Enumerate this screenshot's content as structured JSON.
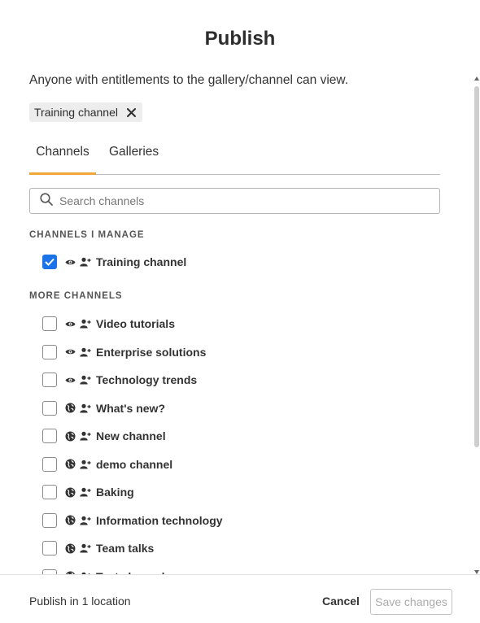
{
  "dialog": {
    "title": "Publish",
    "description": "Anyone with entitlements to the gallery/channel can view.",
    "selected_chip": {
      "label": "Training channel",
      "remove_icon": "close-icon"
    }
  },
  "tabs": [
    {
      "label": "Channels",
      "active": true
    },
    {
      "label": "Galleries",
      "active": false
    }
  ],
  "search": {
    "placeholder": "Search channels",
    "value": "",
    "icon": "search-icon"
  },
  "sections": {
    "managed": {
      "heading": "CHANNELS I MANAGE",
      "items": [
        {
          "label": "Training channel",
          "checked": true,
          "visibility_icon": "eye-icon",
          "member_icon": "person-add-icon"
        }
      ]
    },
    "more": {
      "heading": "MORE CHANNELS",
      "items": [
        {
          "label": "Video tutorials",
          "checked": false,
          "visibility_icon": "eye-icon",
          "member_icon": "person-add-icon"
        },
        {
          "label": "Enterprise solutions",
          "checked": false,
          "visibility_icon": "eye-icon",
          "member_icon": "person-add-icon"
        },
        {
          "label": "Technology trends",
          "checked": false,
          "visibility_icon": "eye-icon",
          "member_icon": "person-add-icon"
        },
        {
          "label": "What's new?",
          "checked": false,
          "visibility_icon": "globe-icon",
          "member_icon": "person-add-icon"
        },
        {
          "label": "New channel",
          "checked": false,
          "visibility_icon": "globe-icon",
          "member_icon": "person-add-icon"
        },
        {
          "label": "demo channel",
          "checked": false,
          "visibility_icon": "globe-icon",
          "member_icon": "person-add-icon"
        },
        {
          "label": "Baking",
          "checked": false,
          "visibility_icon": "globe-icon",
          "member_icon": "person-add-icon"
        },
        {
          "label": "Information technology",
          "checked": false,
          "visibility_icon": "globe-icon",
          "member_icon": "person-add-icon"
        },
        {
          "label": "Team talks",
          "checked": false,
          "visibility_icon": "globe-icon",
          "member_icon": "person-add-icon"
        },
        {
          "label": "Test channel",
          "checked": false,
          "visibility_icon": "globe-icon",
          "member_icon": "person-add-icon"
        }
      ]
    }
  },
  "footer": {
    "status": "Publish in 1 location",
    "cancel_label": "Cancel",
    "save_label": "Save changes",
    "save_disabled": true
  },
  "colors": {
    "accent_tab": "#f0a73a",
    "checkbox_checked": "#1a73e8",
    "text": "#333333",
    "disabled_text": "#aaaaaa"
  }
}
